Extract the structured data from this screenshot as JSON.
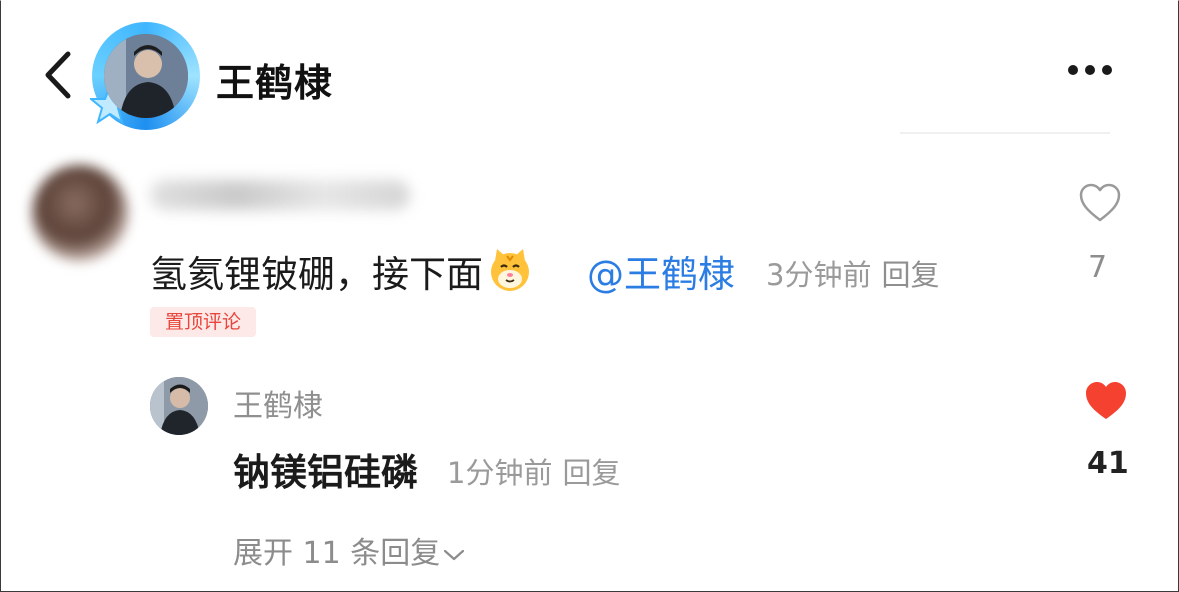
{
  "header": {
    "title": "王鹤棣",
    "back_icon": "chevron-left-icon",
    "more_icon": "more-horizontal-icon"
  },
  "comment": {
    "text": "氢氦锂铍硼，接下面",
    "emoji": "tiger-emoji",
    "mention": "@王鹤棣",
    "time": "3分钟前",
    "reply_label": "回复",
    "pinned_label": "置顶评论",
    "like_count": "7",
    "liked": false
  },
  "reply": {
    "author": "王鹤棣",
    "text": "钠镁铝硅磷",
    "time": "1分钟前",
    "reply_label": "回复",
    "like_count": "41",
    "liked": true,
    "like_color": "#f5412f"
  },
  "expand": {
    "label": "展开 11 条回复"
  },
  "colors": {
    "mention": "#2b7de3",
    "pinned_text": "#e8453c",
    "pinned_bg": "#fde9e7",
    "ring": "#3fb6ff"
  }
}
